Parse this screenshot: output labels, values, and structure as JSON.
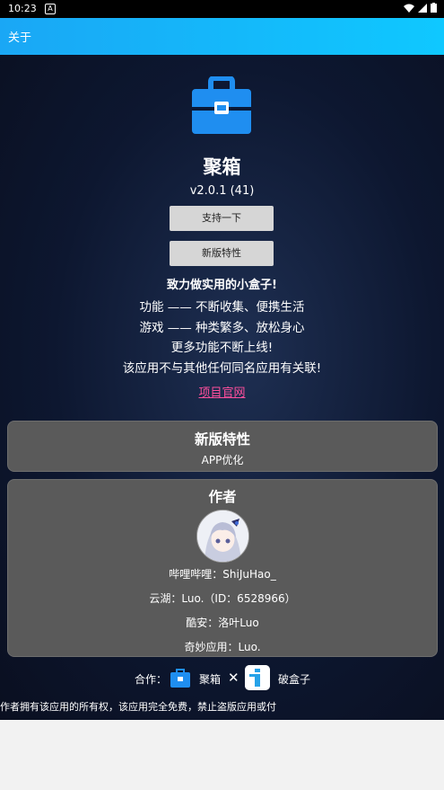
{
  "status": {
    "time": "10:23",
    "notif": "A"
  },
  "appbar": {
    "title": "关于"
  },
  "app": {
    "name": "聚箱",
    "version": "v2.0.1 (41)",
    "support_label": "支持一下",
    "features_label": "新版特性",
    "slogan": "致力做实用的小盒子!",
    "lines": [
      "功能 —— 不断收集、便携生活",
      "游戏 —— 种类繁多、放松身心",
      "更多功能不断上线!",
      "该应用不与其他任何同名应用有关联!"
    ],
    "website": "项目官网"
  },
  "features_card": {
    "title": "新版特性",
    "body": "APP优化"
  },
  "author_card": {
    "title": "作者",
    "bilibili": "哔哩哔哩：ShiJuHao_",
    "yunhu": "云湖：Luo.（ID：6528966）",
    "coolapk": "酷安：洛叶Luo",
    "qimiao": "奇妙应用：Luo."
  },
  "coop": {
    "label": "合作：",
    "partner1": "聚箱",
    "x": "✕",
    "partner2": "破盒子"
  },
  "footer": "作者拥有该应用的所有权，该应用完全免费，禁止盗版应用或付",
  "colors": {
    "appbar": "#1aa7f5",
    "link": "#ff4f9d",
    "card": "#5a5a5a",
    "logo": "#1f8ef0"
  }
}
